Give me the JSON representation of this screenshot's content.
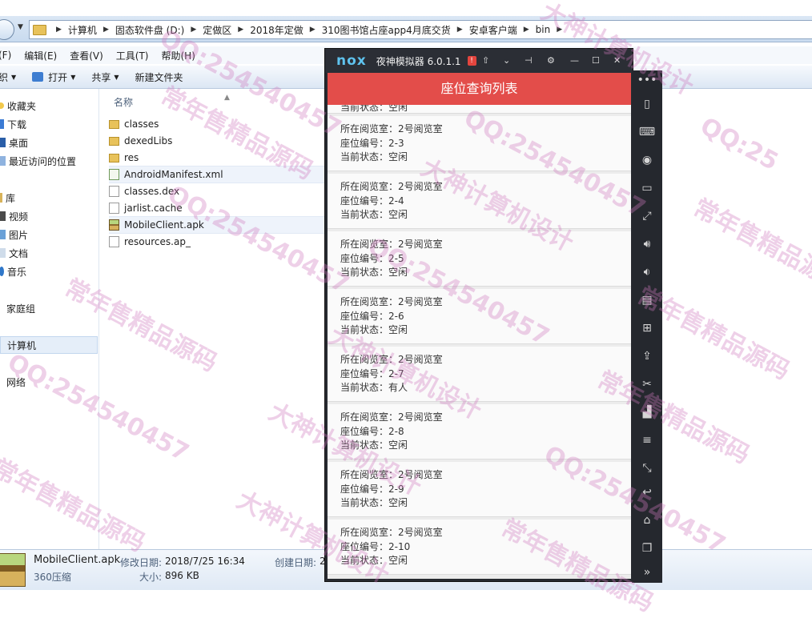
{
  "explorer": {
    "breadcrumbs": [
      "计算机",
      "固态软件盘 (D:)",
      "定做区",
      "2018年定做",
      "310图书馆占座app4月底交货",
      "安卓客户端",
      "bin"
    ],
    "menu": [
      "(F)",
      "编辑(E)",
      "查看(V)",
      "工具(T)",
      "帮助(H)"
    ],
    "toolbar": {
      "organize": "织",
      "open": "打开",
      "share": "共享",
      "new_folder": "新建文件夹"
    },
    "nav": {
      "favorites": "收藏夹",
      "downloads": "下载",
      "desktop": "桌面",
      "recent": "最近访问的位置",
      "libraries": "库",
      "videos": "视频",
      "pictures": "图片",
      "documents": "文档",
      "music": "音乐",
      "homegroup": "家庭组",
      "computer": "计算机",
      "network": "网络"
    },
    "column_name": "名称",
    "files": [
      {
        "name": "classes",
        "type": "folder"
      },
      {
        "name": "dexedLibs",
        "type": "folder"
      },
      {
        "name": "res",
        "type": "folder"
      },
      {
        "name": "AndroidManifest.xml",
        "type": "xml"
      },
      {
        "name": "classes.dex",
        "type": "doc"
      },
      {
        "name": "jarlist.cache",
        "type": "doc"
      },
      {
        "name": "MobileClient.apk",
        "type": "apk"
      },
      {
        "name": "resources.ap_",
        "type": "doc"
      }
    ],
    "status": {
      "file_name": "MobileClient.apk",
      "modified_label": "修改日期:",
      "modified_value": "2018/7/25 16:34",
      "created_label": "创建日期:",
      "created_value": "2",
      "file_type": "360压缩",
      "size_label": "大小:",
      "size_value": "896 KB"
    }
  },
  "emulator": {
    "logo": "nox",
    "title": "夜神模拟器 6.0.1.1",
    "alert": "!",
    "app_title": "座位查询列表",
    "partial_status": "当前状态：空闲",
    "seats": [
      {
        "room": "所在阅览室：2号阅览室",
        "seat": "座位编号：2-3",
        "status": "当前状态：空闲"
      },
      {
        "room": "所在阅览室：2号阅览室",
        "seat": "座位编号：2-4",
        "status": "当前状态：空闲"
      },
      {
        "room": "所在阅览室：2号阅览室",
        "seat": "座位编号：2-5",
        "status": "当前状态：空闲"
      },
      {
        "room": "所在阅览室：2号阅览室",
        "seat": "座位编号：2-6",
        "status": "当前状态：空闲"
      },
      {
        "room": "所在阅览室：2号阅览室",
        "seat": "座位编号：2-7",
        "status": "当前状态：有人"
      },
      {
        "room": "所在阅览室：2号阅览室",
        "seat": "座位编号：2-8",
        "status": "当前状态：空闲"
      },
      {
        "room": "所在阅览室：2号阅览室",
        "seat": "座位编号：2-9",
        "status": "当前状态：空闲"
      },
      {
        "room": "所在阅览室：2号阅览室",
        "seat": "座位编号：2-10",
        "status": "当前状态：空闲"
      }
    ],
    "side_icons": [
      "more-icon",
      "shake-icon",
      "keyboard-icon",
      "location-icon",
      "screen-icon",
      "fullscreen-icon",
      "volume-up-icon",
      "volume-down-icon",
      "toolbox-icon",
      "macro-icon",
      "apk-install-icon",
      "scissors-icon",
      "multi-instance-icon",
      "menu-icon",
      "resize-icon",
      "back-icon",
      "home-icon",
      "recent-apps-icon",
      "expand-icon"
    ]
  },
  "watermarks": [
    "常年售精品源码",
    "QQ:254540457",
    "大神计算机设计",
    "常年售精品源码",
    "QQ:254540457",
    "大神计算机设计",
    "常年售精品源码",
    "QQ:254540457",
    "常年售精品源码",
    "QQ:254540457",
    "大神计算机设计",
    "常年售精品源码",
    "QQ:254540457",
    "大神计算机设计",
    "常年售精品源码",
    "QQ:25"
  ],
  "colors": {
    "app_bar": "#e34d4a",
    "nox_blue": "#5fc3ee",
    "emu_frame": "#272a30"
  }
}
